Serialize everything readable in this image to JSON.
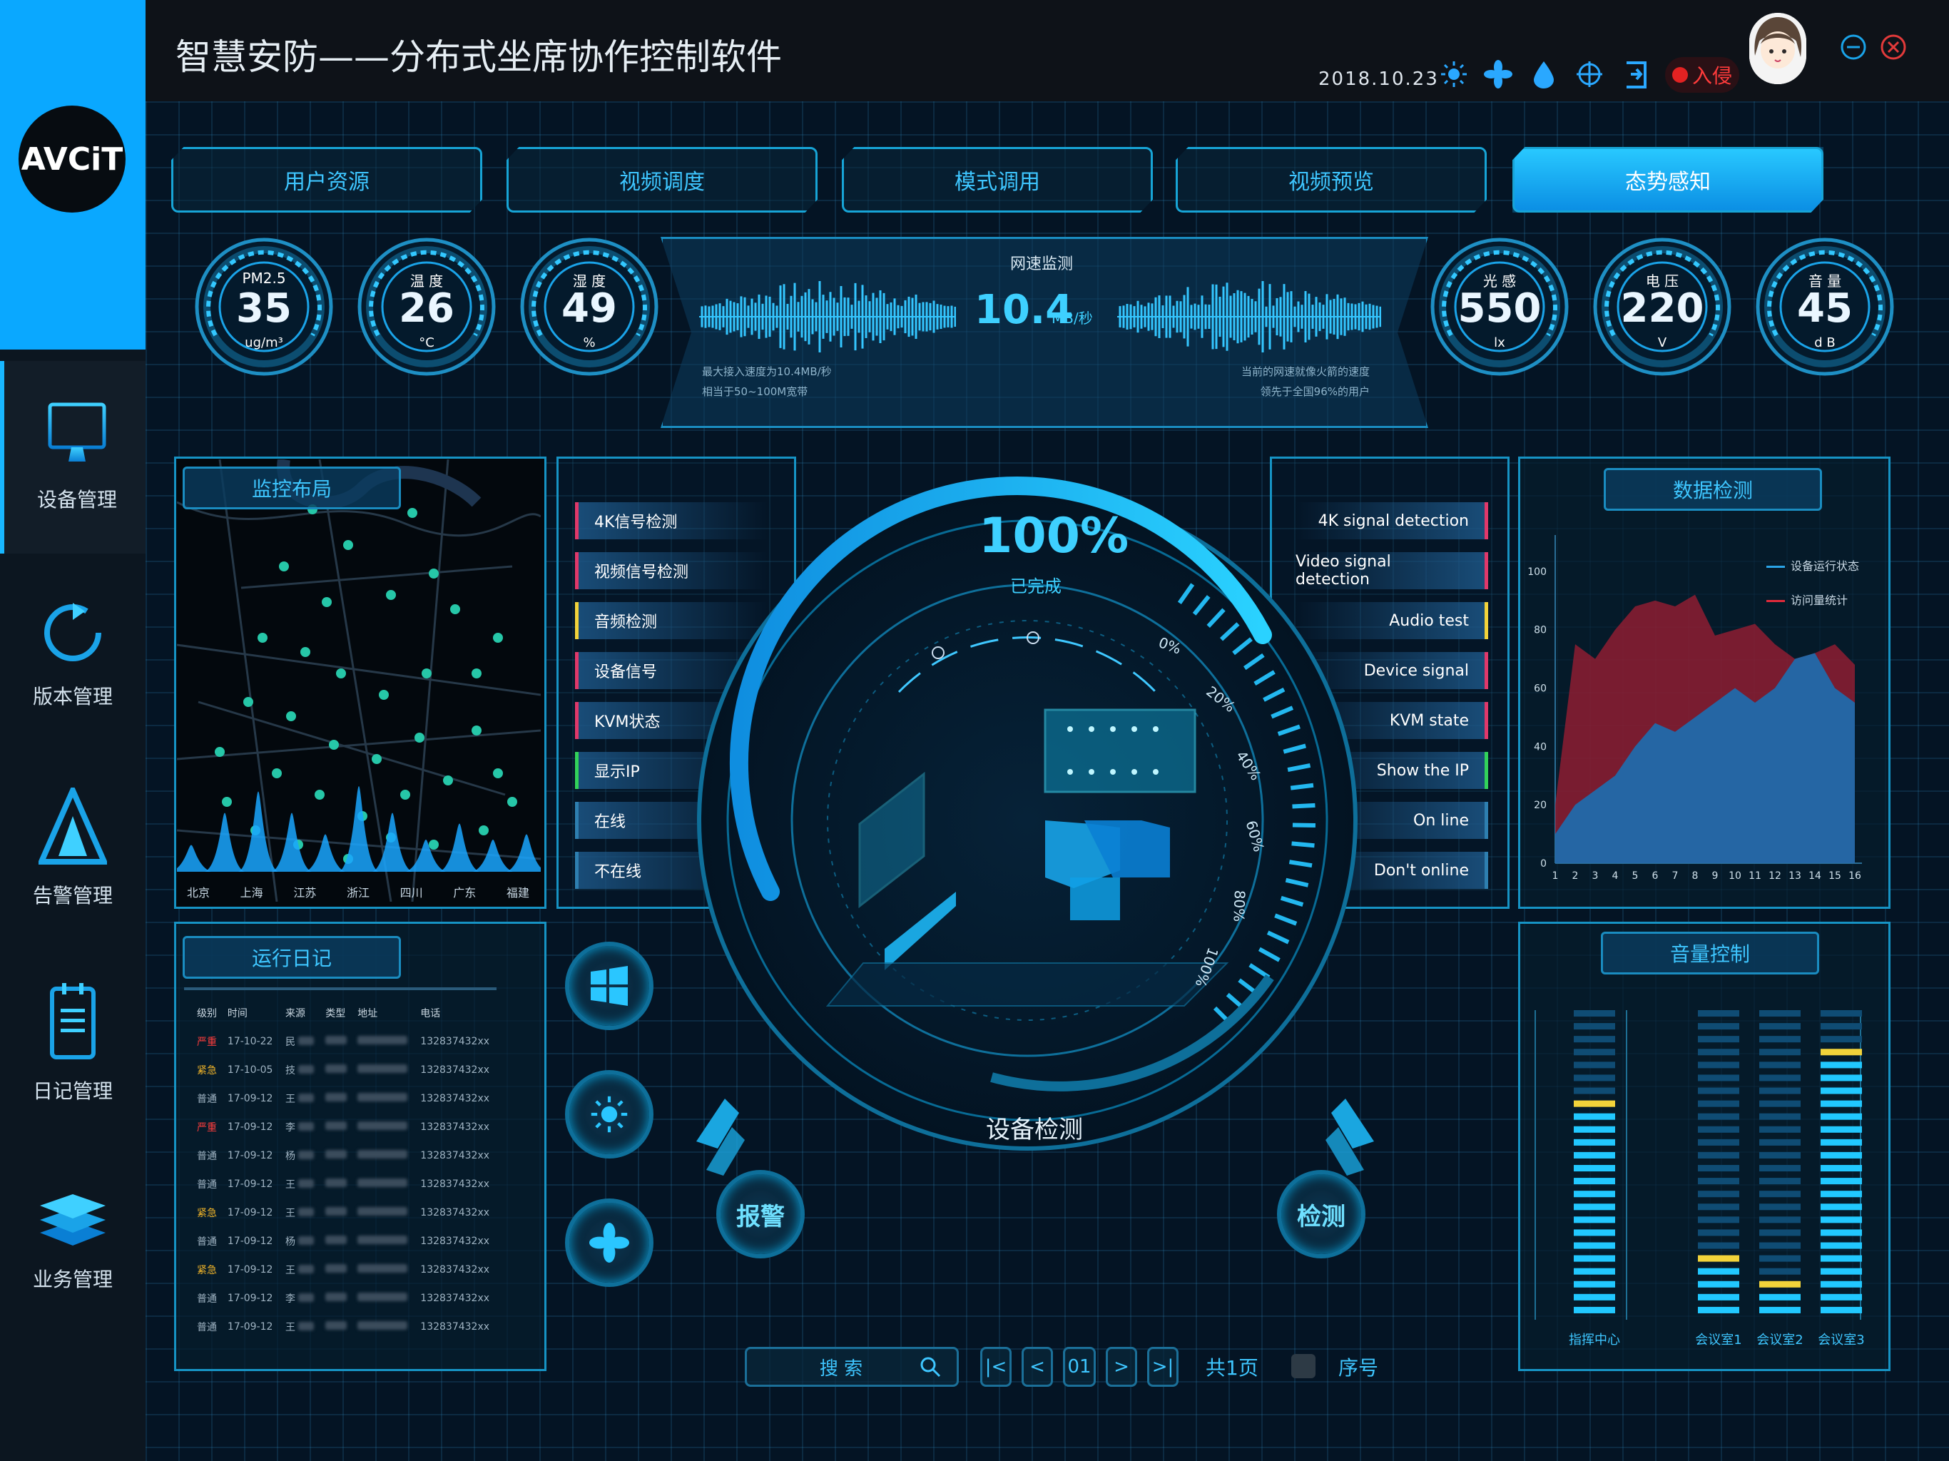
{
  "app": {
    "title": "智慧安防——分布式坐席协作控制软件",
    "logo_text": "AVCiT",
    "date": "2018.10.23",
    "intrusion_label": "入侵"
  },
  "header_icons": [
    "sun-icon",
    "fan-icon",
    "water-drop-icon",
    "crosshair-icon",
    "exit-door-icon",
    "alarm-icon"
  ],
  "sidebar": {
    "items": [
      {
        "label": "设备管理",
        "icon": "monitor-icon",
        "active": true
      },
      {
        "label": "版本管理",
        "icon": "version-ring-icon",
        "active": false
      },
      {
        "label": "告警管理",
        "icon": "warning-triangle-icon",
        "active": false
      },
      {
        "label": "日记管理",
        "icon": "notebook-icon",
        "active": false
      },
      {
        "label": "业务管理",
        "icon": "layers-icon",
        "active": false
      }
    ]
  },
  "tabs": [
    {
      "label": "用户资源",
      "active": false
    },
    {
      "label": "视频调度",
      "active": false
    },
    {
      "label": "模式调用",
      "active": false
    },
    {
      "label": "视频预览",
      "active": false
    },
    {
      "label": "态势感知",
      "active": true
    }
  ],
  "gauges_left": [
    {
      "name": "PM2.5",
      "value": "35",
      "unit": "ug/m³"
    },
    {
      "name": "温 度",
      "value": "26",
      "unit": "°C"
    },
    {
      "name": "湿 度",
      "value": "49",
      "unit": "%"
    }
  ],
  "gauges_right": [
    {
      "name": "光 感",
      "value": "550",
      "unit": "lx"
    },
    {
      "name": "电 压",
      "value": "220",
      "unit": "V"
    },
    {
      "name": "音 量",
      "value": "45",
      "unit": "d B"
    }
  ],
  "network": {
    "title": "网速监测",
    "speed_value": "10.4",
    "speed_unit": "MB/秒",
    "left_note_1": "最大接入速度为10.4MB/秒",
    "left_note_2": "相当于50~100M宽带",
    "right_note_1": "当前的网速就像火箭的速度",
    "right_note_2": "领先于全国96%的用户"
  },
  "map_panel": {
    "title": "监控布局",
    "regions": [
      "北京",
      "上海",
      "江苏",
      "浙江",
      "四川",
      "广东",
      "福建"
    ],
    "peak_levels": [
      0.25,
      0.55,
      0.75,
      0.55,
      0.35,
      0.8,
      0.55,
      0.3,
      0.45,
      0.3,
      0.35
    ]
  },
  "signals_left": [
    {
      "label": "4K信号检测",
      "color": "#e0386a"
    },
    {
      "label": "视频信号检测",
      "color": "#e0386a"
    },
    {
      "label": "音频检测",
      "color": "#f2d33a"
    },
    {
      "label": "设备信号",
      "color": "#e0386a"
    },
    {
      "label": "KVM状态",
      "color": "#e0386a"
    },
    {
      "label": "显示IP",
      "color": "#32d25a"
    },
    {
      "label": "在线",
      "color": "#2e7fb0"
    },
    {
      "label": "不在线",
      "color": "#2e7fb0"
    }
  ],
  "signals_right": [
    {
      "label": "4K signal detection",
      "color": "#e0386a"
    },
    {
      "label": "Video signal detection",
      "color": "#e0386a"
    },
    {
      "label": "Audio test",
      "color": "#f2d33a"
    },
    {
      "label": "Device signal",
      "color": "#e0386a"
    },
    {
      "label": "KVM state",
      "color": "#e0386a"
    },
    {
      "label": "Show the IP",
      "color": "#32d25a"
    },
    {
      "label": "On line",
      "color": "#2e7fb0"
    },
    {
      "label": "Don't online",
      "color": "#2e7fb0"
    }
  ],
  "center": {
    "percent": "100%",
    "status": "已完成",
    "caption": "设备检测",
    "ticks": [
      "0%",
      "20%",
      "40%",
      "60%",
      "80%",
      "100%"
    ],
    "alarm_button": "报警",
    "detect_button": "检测"
  },
  "quick_buttons": [
    "windows-icon",
    "sun-icon",
    "fan-icon"
  ],
  "data_panel": {
    "title": "数据检测",
    "legend": [
      {
        "label": "设备运行状态",
        "color": "#2aa3e6"
      },
      {
        "label": "访问量统计",
        "color": "#e02a3a"
      }
    ],
    "y_ticks": [
      "0",
      "20",
      "40",
      "60",
      "80",
      "100"
    ],
    "x_ticks": [
      "1",
      "2",
      "3",
      "4",
      "5",
      "6",
      "7",
      "8",
      "9",
      "10",
      "11",
      "12",
      "13",
      "14",
      "15",
      "16"
    ]
  },
  "chart_data": {
    "type": "area",
    "x": [
      1,
      2,
      3,
      4,
      5,
      6,
      7,
      8,
      9,
      10,
      11,
      12,
      13,
      14,
      15,
      16
    ],
    "ylim": [
      0,
      110
    ],
    "series": [
      {
        "name": "访问量统计",
        "values": [
          20,
          75,
          70,
          80,
          88,
          90,
          88,
          92,
          78,
          80,
          82,
          75,
          70,
          72,
          75,
          68
        ]
      },
      {
        "name": "设备运行状态",
        "values": [
          10,
          20,
          25,
          30,
          40,
          48,
          45,
          50,
          55,
          60,
          55,
          60,
          70,
          72,
          60,
          55
        ]
      }
    ]
  },
  "log_panel": {
    "title": "运行日记",
    "columns": [
      "级别",
      "时间",
      "来源",
      "类型",
      "地址",
      "电话"
    ],
    "rows": [
      {
        "level": "严重",
        "time": "17-10-22",
        "source": "民",
        "phone": "132837432xx"
      },
      {
        "level": "紧急",
        "time": "17-10-05",
        "source": "技",
        "phone": "132837432xx"
      },
      {
        "level": "普通",
        "time": "17-09-12",
        "source": "王",
        "phone": "132837432xx"
      },
      {
        "level": "严重",
        "time": "17-09-12",
        "source": "李",
        "phone": "132837432xx"
      },
      {
        "level": "普通",
        "time": "17-09-12",
        "source": "杨",
        "phone": "132837432xx"
      },
      {
        "level": "普通",
        "time": "17-09-12",
        "source": "王",
        "phone": "132837432xx"
      },
      {
        "level": "紧急",
        "time": "17-09-12",
        "source": "王",
        "phone": "132837432xx"
      },
      {
        "level": "普通",
        "time": "17-09-12",
        "source": "杨",
        "phone": "132837432xx"
      },
      {
        "level": "紧急",
        "time": "17-09-12",
        "source": "王",
        "phone": "132837432xx"
      },
      {
        "level": "普通",
        "time": "17-09-12",
        "source": "李",
        "phone": "132837432xx"
      },
      {
        "level": "普通",
        "time": "17-09-12",
        "source": "王",
        "phone": "132837432xx"
      }
    ],
    "level_colors": {
      "严重": "#ff3d3d",
      "紧急": "#f0b429",
      "普通": "#9fb3c2"
    }
  },
  "volume_panel": {
    "title": "音量控制",
    "channels": [
      {
        "label": "指挥中心",
        "level": 0.68
      },
      {
        "label": "会议室1",
        "level": 0.18
      },
      {
        "label": "会议室2",
        "level": 0.1
      },
      {
        "label": "会议室3",
        "level": 0.85
      }
    ]
  },
  "pager": {
    "search_label": "搜  索",
    "first": "|<",
    "prev": "<",
    "page": "01",
    "next": ">",
    "last": ">|",
    "total": "共1页",
    "seq_label": "序号"
  }
}
